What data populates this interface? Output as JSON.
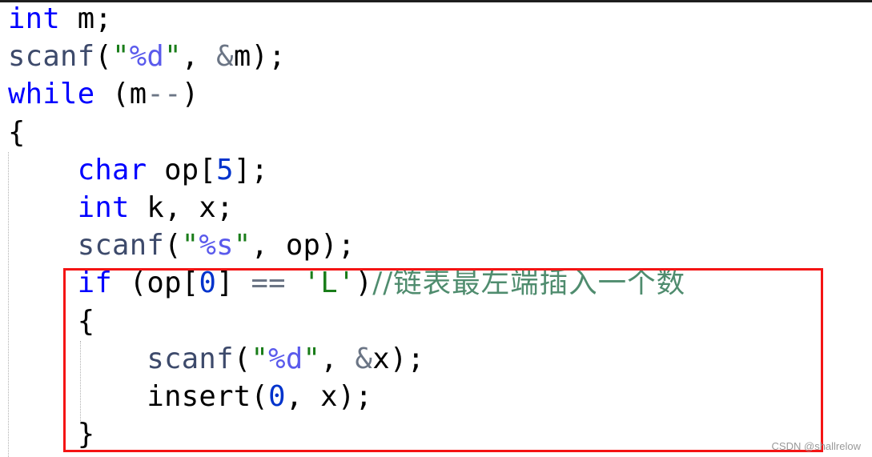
{
  "editor": {
    "lines": [
      {
        "indent": 0,
        "tokens": [
          {
            "t": "int",
            "c": "kw"
          },
          {
            "t": " m;",
            "c": ""
          }
        ]
      },
      {
        "indent": 0,
        "tokens": [
          {
            "t": "scanf",
            "c": "fn"
          },
          {
            "t": "(",
            "c": ""
          },
          {
            "t": "\"",
            "c": "str"
          },
          {
            "t": "%d",
            "c": "fmt"
          },
          {
            "t": "\"",
            "c": "str"
          },
          {
            "t": ", ",
            "c": ""
          },
          {
            "t": "&",
            "c": "op"
          },
          {
            "t": "m);",
            "c": ""
          }
        ]
      },
      {
        "indent": 0,
        "tokens": [
          {
            "t": "while",
            "c": "kw"
          },
          {
            "t": " (m",
            "c": ""
          },
          {
            "t": "--",
            "c": "op"
          },
          {
            "t": ")",
            "c": ""
          }
        ]
      },
      {
        "indent": 0,
        "tokens": [
          {
            "t": "{",
            "c": ""
          }
        ]
      },
      {
        "indent": 1,
        "tokens": [
          {
            "t": "char",
            "c": "kw"
          },
          {
            "t": " op[",
            "c": ""
          },
          {
            "t": "5",
            "c": "num"
          },
          {
            "t": "];",
            "c": ""
          }
        ]
      },
      {
        "indent": 1,
        "tokens": [
          {
            "t": "int",
            "c": "kw"
          },
          {
            "t": " k, x;",
            "c": ""
          }
        ]
      },
      {
        "indent": 1,
        "tokens": [
          {
            "t": "scanf",
            "c": "fn"
          },
          {
            "t": "(",
            "c": ""
          },
          {
            "t": "\"",
            "c": "str"
          },
          {
            "t": "%s",
            "c": "fmt"
          },
          {
            "t": "\"",
            "c": "str"
          },
          {
            "t": ", op);",
            "c": ""
          }
        ]
      },
      {
        "indent": 1,
        "tokens": [
          {
            "t": "if",
            "c": "kw"
          },
          {
            "t": " (op[",
            "c": ""
          },
          {
            "t": "0",
            "c": "num"
          },
          {
            "t": "] ",
            "c": ""
          },
          {
            "t": "==",
            "c": "op"
          },
          {
            "t": " ",
            "c": ""
          },
          {
            "t": "'L'",
            "c": "str"
          },
          {
            "t": ")",
            "c": ""
          },
          {
            "t": "//链表最左端插入一个数",
            "c": "cmt"
          }
        ]
      },
      {
        "indent": 1,
        "tokens": [
          {
            "t": "{",
            "c": ""
          }
        ]
      },
      {
        "indent": 2,
        "tokens": [
          {
            "t": "scanf",
            "c": "fn"
          },
          {
            "t": "(",
            "c": ""
          },
          {
            "t": "\"",
            "c": "str"
          },
          {
            "t": "%d",
            "c": "fmt"
          },
          {
            "t": "\"",
            "c": "str"
          },
          {
            "t": ", ",
            "c": ""
          },
          {
            "t": "&",
            "c": "op"
          },
          {
            "t": "x);",
            "c": ""
          }
        ]
      },
      {
        "indent": 2,
        "tokens": [
          {
            "t": "insert(",
            "c": ""
          },
          {
            "t": "0",
            "c": "num"
          },
          {
            "t": ", x);",
            "c": ""
          }
        ]
      },
      {
        "indent": 1,
        "tokens": [
          {
            "t": "}",
            "c": ""
          }
        ]
      }
    ]
  },
  "annotation": {
    "color": "#f41414",
    "highlighted_lines": [
      8,
      12
    ]
  },
  "watermark": "CSDN @shallrelow"
}
